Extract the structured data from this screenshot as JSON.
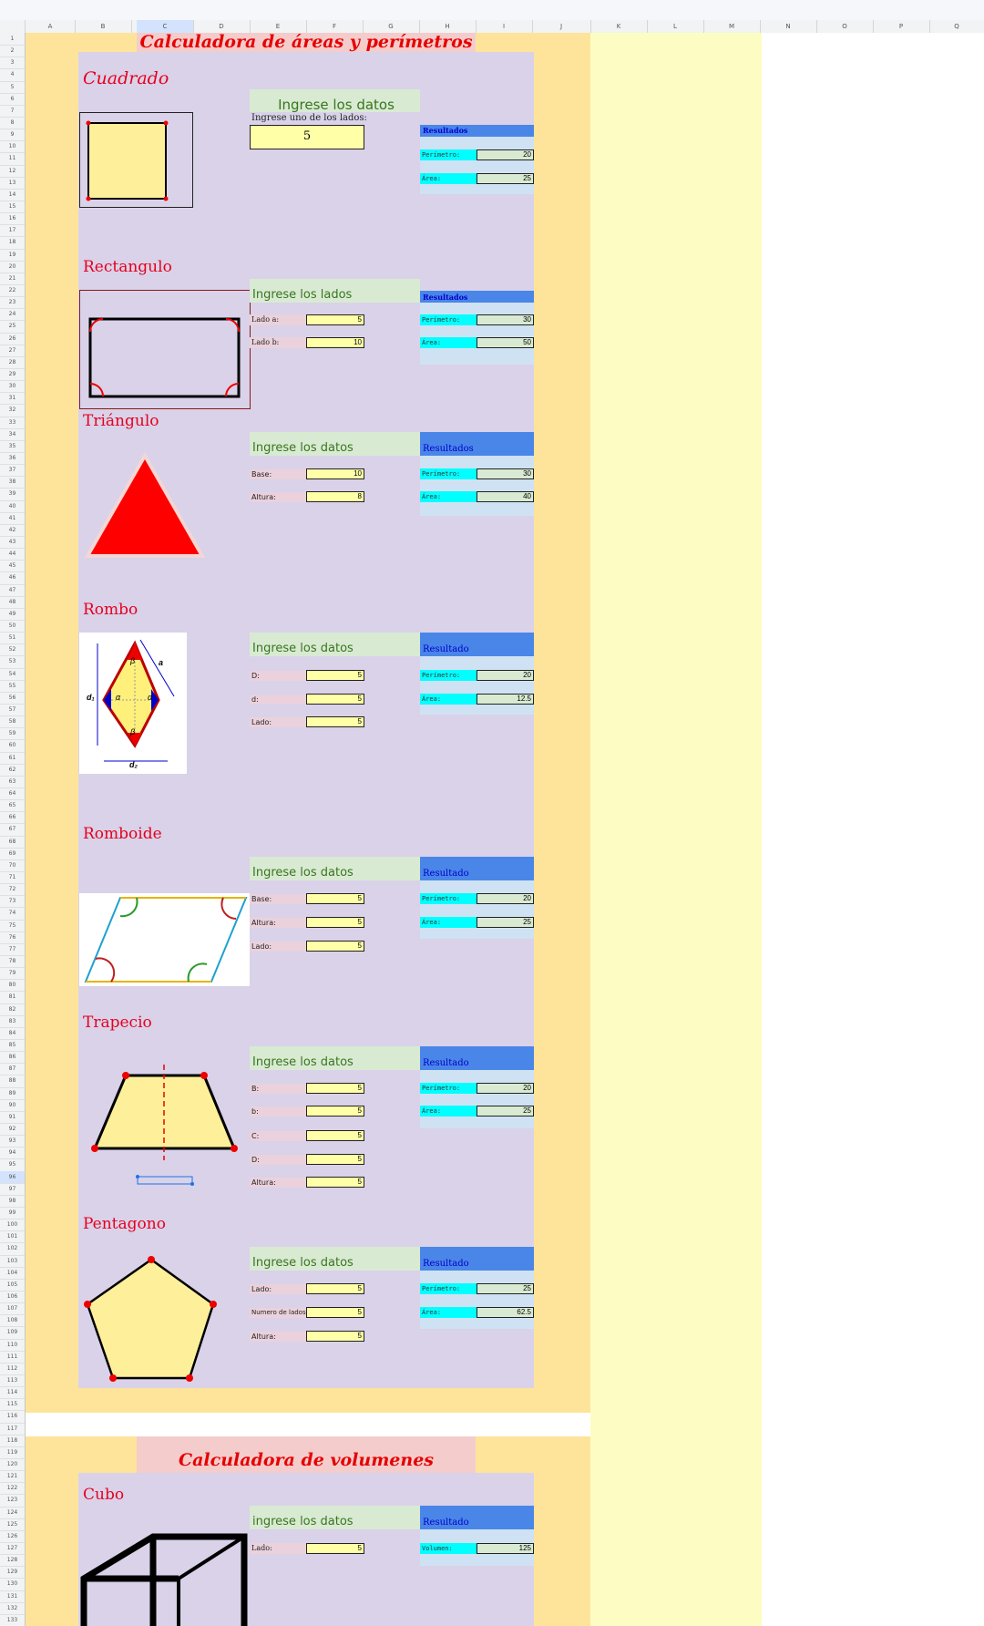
{
  "columns": [
    "A",
    "B",
    "C",
    "D",
    "E",
    "F",
    "G",
    "H",
    "I",
    "J",
    "K",
    "L",
    "M",
    "N",
    "O",
    "P",
    "Q"
  ],
  "selected_column": "C",
  "selected_row": "96",
  "areas_title": "Calculadora de áreas y perímetros",
  "volumes_title": "Calculadora de volumenes",
  "shapes": {
    "cuadrado": {
      "title": "Cuadrado",
      "input_header": "Ingrese los datos",
      "input_label": "Ingrese uno de los lados:",
      "input_value": "5",
      "results_header": "Resultados",
      "results": [
        {
          "label": "Perímetro:",
          "value": "20"
        },
        {
          "label": "Área:",
          "value": "25"
        }
      ]
    },
    "rectangulo": {
      "title": "Rectangulo",
      "input_header": "Ingrese los lados",
      "inputs": [
        {
          "label": "Lado a:",
          "value": "5"
        },
        {
          "label": "Lado b:",
          "value": "10"
        }
      ],
      "results_header": "Resultados",
      "results": [
        {
          "label": "Perímetro:",
          "value": "30"
        },
        {
          "label": "Área:",
          "value": "50"
        }
      ]
    },
    "triangulo": {
      "title": "Triángulo",
      "input_header": "Ingrese los datos",
      "inputs": [
        {
          "label": "Base:",
          "value": "10"
        },
        {
          "label": "Altura:",
          "value": "8"
        }
      ],
      "results_header": "Resultados",
      "results": [
        {
          "label": "Perímetro:",
          "value": "30"
        },
        {
          "label": "Área:",
          "value": "40"
        }
      ]
    },
    "rombo": {
      "title": "Rombo",
      "input_header": "Ingrese los datos",
      "inputs": [
        {
          "label": "D:",
          "value": "5"
        },
        {
          "label": "d:",
          "value": "5"
        },
        {
          "label": "Lado:",
          "value": "5"
        }
      ],
      "results_header": "Resultado",
      "results": [
        {
          "label": "Perímetro:",
          "value": "20"
        },
        {
          "label": "Área:",
          "value": "12.5"
        }
      ],
      "diagram_labels": {
        "d1": "d₁",
        "d2": "d₂",
        "a": "a",
        "alpha": "α",
        "beta": "β"
      }
    },
    "romboide": {
      "title": "Romboide",
      "input_header": "Ingrese los datos",
      "inputs": [
        {
          "label": "Base:",
          "value": "5"
        },
        {
          "label": "Altura:",
          "value": "5"
        },
        {
          "label": "Lado:",
          "value": "5"
        }
      ],
      "results_header": "Resultado",
      "results": [
        {
          "label": "Perímetro:",
          "value": "20"
        },
        {
          "label": "Área:",
          "value": "25"
        }
      ]
    },
    "trapecio": {
      "title": "Trapecio",
      "input_header": "Ingrese los datos",
      "inputs": [
        {
          "label": "B:",
          "value": "5"
        },
        {
          "label": "b:",
          "value": "5"
        },
        {
          "label": "C:",
          "value": "5"
        },
        {
          "label": "D:",
          "value": "5"
        },
        {
          "label": "Altura:",
          "value": "5"
        }
      ],
      "results_header": "Resultado",
      "results": [
        {
          "label": "Perímetro:",
          "value": "20"
        },
        {
          "label": "Área:",
          "value": "25"
        }
      ]
    },
    "pentagono": {
      "title": "Pentagono",
      "input_header": "Ingrese los datos",
      "inputs": [
        {
          "label": "Lado:",
          "value": "5"
        },
        {
          "label": "Numero de lados:",
          "value": "5"
        },
        {
          "label": "Altura:",
          "value": "5"
        }
      ],
      "results_header": "Resultado",
      "results": [
        {
          "label": "Perímetro:",
          "value": "25"
        },
        {
          "label": "Área:",
          "value": "62.5"
        }
      ]
    },
    "cubo": {
      "title": "Cubo",
      "input_header": "ingrese los datos",
      "inputs": [
        {
          "label": "Lado:",
          "value": "5"
        }
      ],
      "results_header": "Resultado",
      "results": [
        {
          "label": "Volumen:",
          "value": "125"
        }
      ]
    }
  },
  "colors": {
    "orange_bg": "#fde49a",
    "pale_yellow": "#fdfdc3",
    "purple_panel": "#d9d2e9",
    "title_red": "#e60000",
    "results_blue": "#4a86e8",
    "result_label_cyan": "#00ffff",
    "input_yellow": "#ffffa8"
  }
}
